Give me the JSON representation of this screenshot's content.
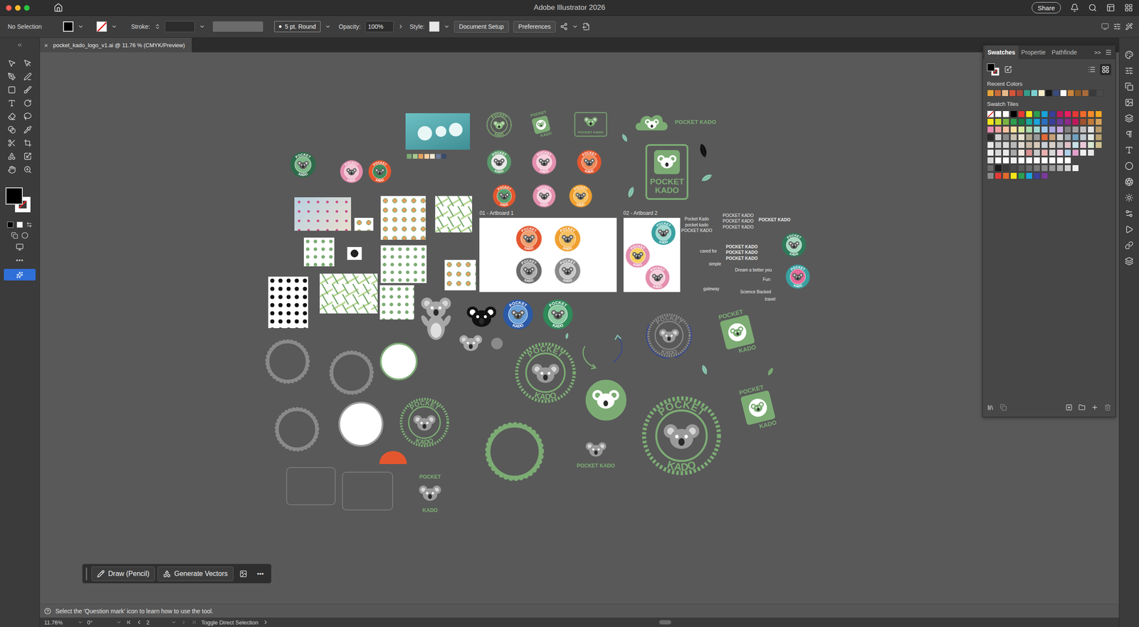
{
  "window": {
    "title": "Adobe Illustrator 2026",
    "share": "Share"
  },
  "control_bar": {
    "selection": "No Selection",
    "stroke_label": "Stroke:",
    "brush": "5 pt. Round",
    "opacity_label": "Opacity:",
    "opacity": "100%",
    "style_label": "Style:",
    "buttons": [
      "Document Setup",
      "Preferences"
    ]
  },
  "document_tab": {
    "title": "pocket_kado_logo_v1.ai @ 11.76 % (CMYK/Preview)",
    "close": "×"
  },
  "toolbar": {
    "more": "•••"
  },
  "swatches_panel": {
    "tabs": [
      {
        "label": "Swatches",
        "selected": true
      },
      {
        "label": "Propertie",
        "selected": false
      },
      {
        "label": "Pathfinde",
        "selected": false
      }
    ],
    "overflow": ">>",
    "views": [
      {
        "mode": "list",
        "selected": false
      },
      {
        "mode": "grid",
        "selected": true
      }
    ],
    "recent_label": "Recent Colors",
    "recent_colors": [
      "#e8a33a",
      "#c86a3a",
      "#e8b98a",
      "#d4553a",
      "#a84a3a",
      "#3a9a8a",
      "#7ad0d0",
      "#f5ecc8",
      "#1a1a1a",
      "#3a4a7a",
      "#ffffff",
      "#c8843a",
      "#8a5a2a",
      "#a86a3a",
      "#3a3a3a",
      "#4a4a4a"
    ],
    "tiles_label": "Swatch Tiles",
    "tile_rows": [
      [
        "#ffffff",
        "#ffffff",
        "#000000",
        "#e53935",
        "#f5e51b",
        "#2e9e4f",
        "#1aa3dd",
        "#3a3f9a",
        "#c2185b",
        "#e91e63",
        "#e53935",
        "#f06a2a",
        "#f58a2a",
        "#f5a623"
      ],
      [
        "#f5e51b",
        "#c6d92a",
        "#7cb342",
        "#2e9e4f",
        "#1b7a43",
        "#19a89a",
        "#1aa3dd",
        "#2a6fc0",
        "#3a3f9a",
        "#6a3a9a",
        "#8e2a8a",
        "#c2185b",
        "#a0522d",
        "#c07a3a",
        "#d4a05a"
      ],
      [
        "#e88ab0",
        "#f0a0a0",
        "#f5c0a0",
        "#f5e0a0",
        "#d8e8a0",
        "#a8d8a8",
        "#a0d8d0",
        "#a0c8e8",
        "#a8a8e0",
        "#c8a8e0",
        "#808080",
        "#a0a0a0",
        "#c0c0c0",
        "#e0e0e0",
        "#b89a6a"
      ],
      [
        "#2a2a2a",
        "#d0d0d0",
        "#8a8a8a",
        "#c8c0b0",
        "#e8e0d0",
        "#b0a890",
        "#9a9a9a",
        "#e06a3a",
        "#c8a07a",
        "#d0d0d0",
        "#a0a8b0",
        "#70a0c0",
        "#c0c8d0",
        "#e0e8e0",
        "#b8a070"
      ],
      [
        "#e8e8e8",
        "#c8c8c8",
        "#d8d8d8",
        "#b8b8b8",
        "#e0d8d0",
        "#c8b8a8",
        "#d8c8b8",
        "#c8d0d8",
        "#d8d0c8",
        "#c0c0c0",
        "#e0c0c8",
        "#c8e0e8",
        "#e8c8d8",
        "#d8e8d0",
        "#d0c090"
      ],
      [
        "#f0f0f0",
        "#d8d8d8",
        "#e8e8e8",
        "#a8a8a8",
        "#f0e8e0",
        "#d89090",
        "#c8c8c8",
        "#e8b0b0",
        "#d8d8d8",
        "#f0d0e0",
        "#b0d0e8",
        "#e0a0c8",
        "#f0f0f0",
        "#e8e8e8"
      ],
      [
        "#d8d8d8",
        "#ffffff",
        "#ffffff",
        "#f0f0f0",
        "#ffffff",
        "#ffffff",
        "#ffffff",
        "#ffffff",
        "#ffffff",
        "#ffffff",
        "#ffffff"
      ],
      [
        "#6a6a6a",
        "#1a1a1a",
        "#3a3a3a",
        "#4a4a4a",
        "#5a5a5a",
        "#6a6a6a",
        "#7a7a7a",
        "#8a8a8a",
        "#9a9a9a",
        "#b0b0b0",
        "#d0d0d0",
        "#f0f0f0"
      ],
      [
        "#8a8a8a",
        "#e53935",
        "#e06a2a",
        "#f5e51b",
        "#2e9e4f",
        "#1aa3dd",
        "#3a3f9a",
        "#7a3a9a"
      ]
    ]
  },
  "canvas": {
    "artboards": [
      {
        "label": "01 - Artboard 1",
        "badges": [
          {
            "kind": "solid",
            "top": "POCKET",
            "bottom": "KADO",
            "ring": "#e4572e",
            "accent": "#f0a070"
          },
          {
            "kind": "solid",
            "top": "POCKET",
            "bottom": "KADO",
            "ring": "#f0a030",
            "accent": "#f5c060"
          },
          {
            "kind": "solid",
            "top": "POCKET",
            "bottom": "KADO",
            "ring": "#6a6a6a",
            "accent": "#b0b0b0"
          },
          {
            "kind": "solid",
            "top": "POCKET",
            "bottom": "KADO",
            "ring": "#8a8a8a",
            "accent": "#c8c8c8"
          }
        ]
      },
      {
        "label": "02 - Artboard 2",
        "badges": [
          {
            "kind": "solid",
            "top": "POCKET",
            "bottom": "KADO",
            "ring": "#3aa0a0",
            "accent": "#a0d8d0"
          },
          {
            "kind": "solid",
            "top": "POCKET",
            "bottom": "KADO",
            "ring": "#e48fae",
            "accent": "#f5d060"
          },
          {
            "kind": "solid",
            "top": "POCKET",
            "bottom": "KADO",
            "ring": "#e48fae",
            "accent": "#f5d0dc"
          }
        ]
      }
    ],
    "badges": [
      {
        "kind": "solid",
        "top": "POCKET",
        "bottom": "KADO",
        "ring": "#2f6b4a",
        "accent": "#7fb88a"
      },
      {
        "kind": "solid",
        "top": "POCKET",
        "bottom": "KADO",
        "ring": "#e48fae",
        "accent": "#f3c6d4"
      },
      {
        "kind": "solid",
        "top": "POCKET",
        "bottom": "KADO",
        "ring": "#e4572e",
        "accent": "#3f8a5a"
      },
      {
        "kind": "outline",
        "top": "POCKET",
        "bottom": "KADO",
        "ring": "#8bbf7e",
        "accent": "#8bbf7e"
      },
      {
        "kind": "solid",
        "top": "POCKET",
        "bottom": "KADO",
        "ring": "#5a9a6a",
        "accent": "#e8e8e8"
      },
      {
        "kind": "solid",
        "top": "POCKET",
        "bottom": "KADO",
        "ring": "#e48fae",
        "accent": "#f5d0dc"
      },
      {
        "kind": "solid",
        "top": "POCKET",
        "bottom": "KADO",
        "ring": "#e4572e",
        "accent": "#f08a5a"
      },
      {
        "kind": "solid",
        "top": "POCKET",
        "bottom": "KADO",
        "ring": "#e4572e",
        "accent": "#5aa070"
      },
      {
        "kind": "solid",
        "top": "POCKET",
        "bottom": "KADO",
        "ring": "#e48fae",
        "accent": "#f5d0dc"
      },
      {
        "kind": "solid",
        "top": "POCKET",
        "bottom": "KADO",
        "ring": "#f0a030",
        "accent": "#f5c060"
      },
      {
        "kind": "solid",
        "top": "POCKET",
        "bottom": "KADO",
        "ring": "#2f7a5a",
        "accent": "#a8d8c0"
      },
      {
        "kind": "solid",
        "top": "POCKET",
        "bottom": "KADO",
        "ring": "#3aa0a0",
        "accent": "#e86a9a"
      },
      {
        "kind": "solid",
        "top": "POCKET",
        "bottom": "KADO",
        "ring": "#2a5aa8",
        "accent": "#6aa0d8"
      },
      {
        "kind": "solid",
        "top": "POCKET",
        "bottom": "KADO",
        "ring": "#2f8a5a",
        "accent": "#8ac8a0"
      },
      {
        "kind": "outline",
        "top": "POCKET",
        "bottom": "KADO",
        "ring": "#7cac74",
        "accent": "#9a9a9a"
      },
      {
        "kind": "outline",
        "top": "POCKET",
        "bottom": "KADO",
        "ring": "#7cac74",
        "accent": "#9a9a9a"
      },
      {
        "kind": "outline",
        "top": "POCKET",
        "bottom": "KADO",
        "ring": "#8a8a8a",
        "accent": "#9a9a9a"
      },
      {
        "kind": "outline",
        "top": "POCKET",
        "bottom": "KADO",
        "ring": "#7cac74",
        "accent": "#9a9a9a"
      }
    ],
    "logos": [
      {
        "kind": "card",
        "lines": [
          "POCKET",
          "KADO"
        ],
        "color": "#7cac74"
      },
      {
        "kind": "frame",
        "lines": [
          "POCKET KADO"
        ],
        "color": "#7cac74"
      },
      {
        "kind": "cloud",
        "lines": [
          "POCKET KADO"
        ],
        "color": "#7cac74"
      },
      {
        "kind": "tall",
        "lines": [
          "POCKET",
          "KADO"
        ],
        "color": "#7cac74"
      },
      {
        "kind": "card",
        "lines": [
          "POCKET",
          "KADO"
        ],
        "color": "#7cac74"
      },
      {
        "kind": "card",
        "lines": [
          "POCKET",
          "KADO"
        ],
        "color": "#7cac74"
      },
      {
        "kind": "stacked",
        "lines": [
          "POCKET KADO"
        ],
        "color": "#7cac74"
      },
      {
        "kind": "sandwich",
        "lines": [
          "POCKET",
          "KADO"
        ],
        "color": "#7cac74"
      }
    ],
    "texts": [
      {
        "text": "Pocket Kado",
        "kind": "plain"
      },
      {
        "text": "pocket kado",
        "kind": "plain"
      },
      {
        "text": "POCKET KADO",
        "kind": "plain"
      },
      {
        "text": "POCKET KADO",
        "kind": "plain"
      },
      {
        "text": "POCKET KADO",
        "kind": "plain"
      },
      {
        "text": "POCKET KADO",
        "kind": "plain"
      },
      {
        "text": "POCKET KADO",
        "kind": "bold"
      },
      {
        "text": "POCKET KADO",
        "kind": "bold"
      },
      {
        "text": "POCKET KADO",
        "kind": "bold"
      },
      {
        "text": "POCKET KADO",
        "kind": "bold"
      },
      {
        "text": "cared for",
        "kind": "plain"
      },
      {
        "text": "simple",
        "kind": "plain"
      },
      {
        "text": "gateway",
        "kind": "plain"
      },
      {
        "text": "Dream a better you",
        "kind": "plain"
      },
      {
        "text": "Fun",
        "kind": "plain"
      },
      {
        "text": "Science Backed",
        "kind": "plain"
      },
      {
        "text": "travel",
        "kind": "plain"
      }
    ]
  },
  "task_bar": {
    "buttons": [
      "Draw (Pencil)",
      "Generate Vectors"
    ],
    "more": "•••"
  },
  "help": "Select the 'Question mark' icon to learn how to use the tool.",
  "status_bar": {
    "zoom": "11.76%",
    "rotation": "0°",
    "artboard": "2",
    "tool": "Toggle Direct Selection"
  }
}
